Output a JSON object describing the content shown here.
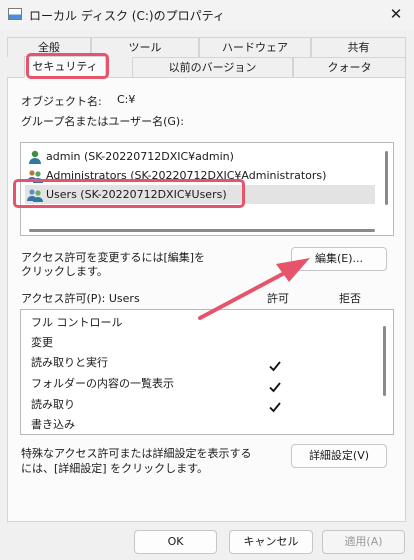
{
  "window": {
    "title": "ローカル ディスク (C:)のプロパティ",
    "close_glyph": "✕"
  },
  "tabs_row1": [
    {
      "label": "全般"
    },
    {
      "label": "ツール"
    },
    {
      "label": "ハードウェア"
    },
    {
      "label": "共有"
    }
  ],
  "tabs_row2": [
    {
      "label": "セキュリティ",
      "active": true
    },
    {
      "label": "以前のバージョン"
    },
    {
      "label": "クォータ"
    }
  ],
  "security": {
    "object_name_label": "オブジェクト名:",
    "object_name_value": "C:¥",
    "group_label": "グループ名またはユーザー名(G):",
    "users": [
      {
        "name": "admin (SK-20220712DXIC¥admin)",
        "icon": "user-icon"
      },
      {
        "name": "Administrators (SK-20220712DXIC¥Administrators)",
        "icon": "group-icon"
      },
      {
        "name": "Users (SK-20220712DXIC¥Users)",
        "icon": "group-icon",
        "selected": true
      }
    ],
    "change_text_line1": "アクセス許可を変更するには[編集]を",
    "change_text_line2": "クリックします。",
    "edit_button": "編集(E)...",
    "perm_header": "アクセス許可(P): Users",
    "col_allow": "許可",
    "col_deny": "拒否",
    "permissions": [
      {
        "name": "フル コントロール",
        "allow": false,
        "deny": false
      },
      {
        "name": "変更",
        "allow": false,
        "deny": false
      },
      {
        "name": "読み取りと実行",
        "allow": true,
        "deny": false
      },
      {
        "name": "フォルダーの内容の一覧表示",
        "allow": true,
        "deny": false
      },
      {
        "name": "読み取り",
        "allow": true,
        "deny": false
      },
      {
        "name": "書き込み",
        "allow": false,
        "deny": false
      }
    ],
    "advanced_text_line1": "特殊なアクセス許可または詳細設定を表示する",
    "advanced_text_line2": "には、[詳細設定] をクリックします。",
    "advanced_button": "詳細設定(V)"
  },
  "footer": {
    "ok": "OK",
    "cancel": "キャンセル",
    "apply": "適用(A)"
  },
  "colors": {
    "annotation_red": "#e5546b",
    "check": "#111111"
  }
}
